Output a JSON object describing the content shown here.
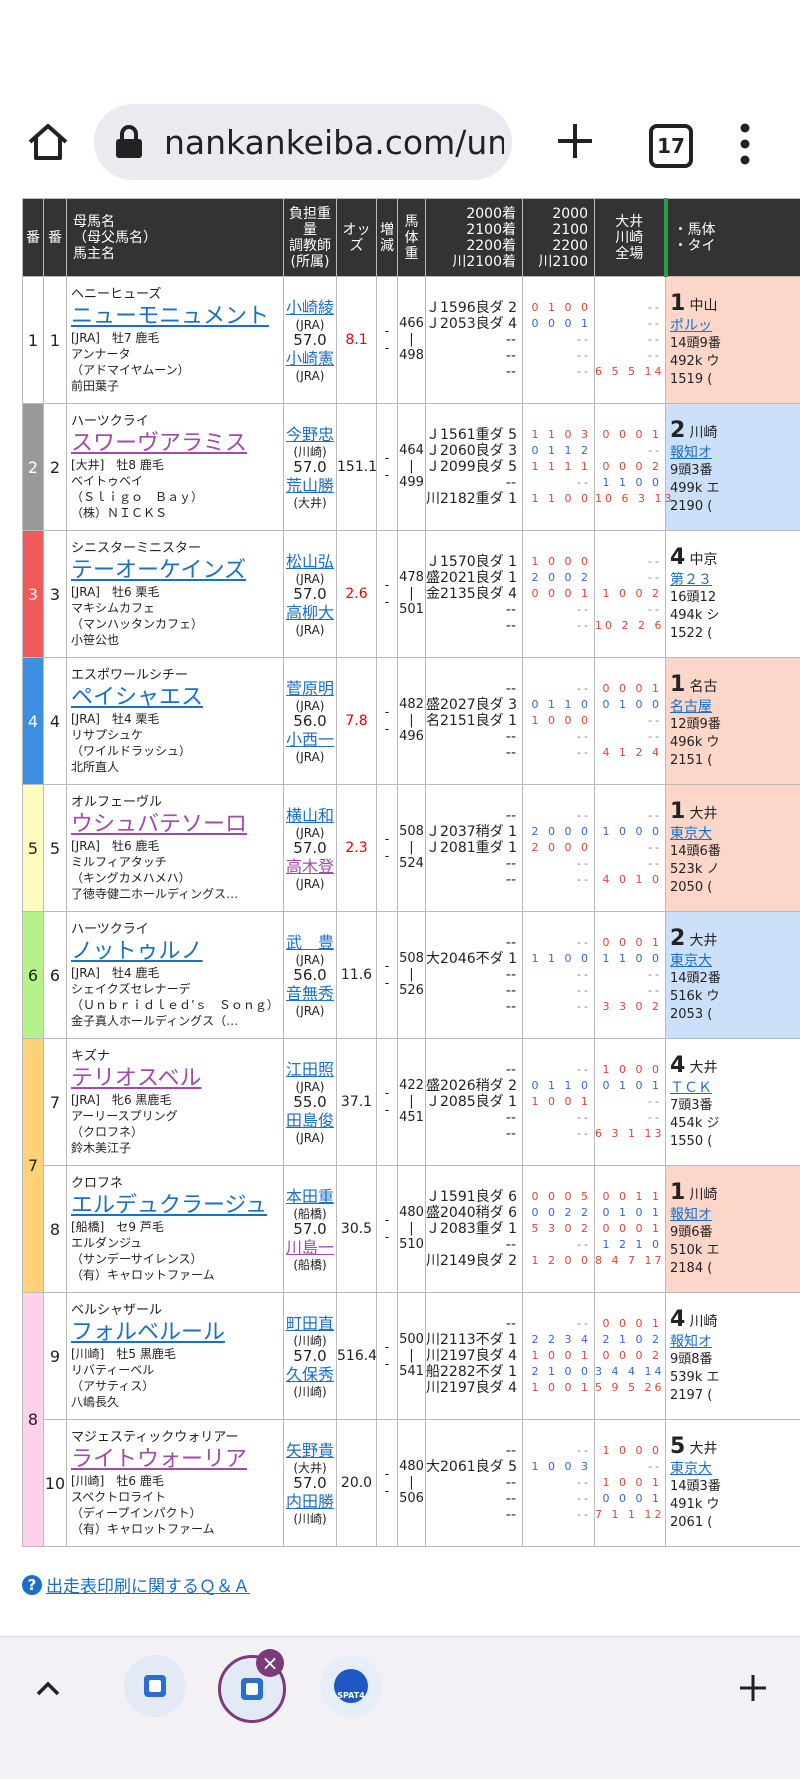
{
  "browser": {
    "url": "nankankeiba.com/um",
    "tab_count": "17"
  },
  "colors": {
    "header_bg": "#333333",
    "waku": [
      "#ffffff",
      "#999999",
      "#f05a5a",
      "#3a8fe0",
      "#fdfcc0",
      "#b6f28a",
      "#ffd27a",
      "#ffd1ea"
    ],
    "accent_link": "#1a6fc6",
    "odds_red": "#e00000"
  },
  "table": {
    "headers": {
      "waku": "番",
      "num": "番",
      "horse": [
        "母馬名",
        "（母父馬名）",
        "馬主名"
      ],
      "trainer": [
        "負担重量",
        "調教師",
        "(所属)"
      ],
      "odds": "オッズ",
      "change": "増減",
      "weight": "馬体重",
      "times": [
        "2000着",
        "2100着",
        "2200着",
        "川2100着"
      ],
      "dist": [
        "2000",
        "2100",
        "2200",
        "川2100"
      ],
      "tracks": [
        "大井",
        "川崎",
        "全場"
      ],
      "last": [
        "・馬体",
        "・タイ"
      ]
    },
    "waku_labels": [
      "1",
      "2",
      "3",
      "4",
      "5",
      "6",
      "7",
      "8"
    ],
    "rows": [
      {
        "num": "1",
        "sire": "ヘニーヒューズ",
        "name": "ニューモニュメント",
        "info": "[JRA]　牡7 鹿毛",
        "dam": "アンナータ",
        "damsire": "（アドマイヤムーン）",
        "owner": "前田葉子",
        "jockey": "小崎綾",
        "jockey_aff": "(JRA)",
        "weight": "57.0",
        "trainer": "小崎憲",
        "trainer_aff": "(JRA)",
        "odds": "8.1",
        "change": "-",
        "bw1": "466",
        "bw2": "498",
        "times": [
          "Ｊ1596良ダ 2",
          "Ｊ2053良ダ 4",
          "--",
          "--",
          "--"
        ],
        "rec": [
          "0 1 0 0",
          "0 0 0 1",
          "--",
          "--",
          "--"
        ],
        "rec2": [
          "--",
          "--",
          "--",
          "--",
          "6 5 5 14"
        ],
        "last_pos": "1",
        "last_place": "中山",
        "last_race": "ポルッ",
        "last_detail": [
          "14頭9番",
          "492k ウ",
          "1519 ("
        ]
      },
      {
        "num": "2",
        "sire": "ハーツクライ",
        "name": "スワーヴアラミス",
        "info": "[大井]　牡8 鹿毛",
        "dam": "ベイトゥベイ",
        "damsire": "（Ｓｌｉｇｏ　Ｂａｙ）",
        "owner": "（株）ＮＩＣＫＳ",
        "jockey": "今野忠",
        "jockey_aff": "(川崎)",
        "weight": "57.0",
        "trainer": "荒山勝",
        "trainer_aff": "(大井)",
        "odds": "151.1",
        "change": "-",
        "bw1": "464",
        "bw2": "499",
        "times": [
          "Ｊ1561重ダ 5",
          "Ｊ2060良ダ 3",
          "Ｊ2099良ダ 5",
          "--",
          "川2182重ダ 1"
        ],
        "rec": [
          "1 1 0 3",
          "0 1 1 2",
          "1 1 1 1",
          "--",
          "1 1 0 0"
        ],
        "rec2": [
          "0 0 0 1",
          "--",
          "0 0 0 2",
          "1 1 0 0",
          "10 6 3 13"
        ],
        "last_pos": "2",
        "last_place": "川崎",
        "last_race": "報知オ",
        "last_detail": [
          "9頭3番",
          "499k エ",
          "2190 ("
        ]
      },
      {
        "num": "3",
        "sire": "シニスターミニスター",
        "name": "テーオーケインズ",
        "info": "[JRA]　牡6 栗毛",
        "dam": "マキシムカフェ",
        "damsire": "（マンハッタンカフェ）",
        "owner": "小笹公也",
        "jockey": "松山弘",
        "jockey_aff": "(JRA)",
        "weight": "57.0",
        "trainer": "高柳大",
        "trainer_aff": "(JRA)",
        "odds": "2.6",
        "change": "-",
        "bw1": "478",
        "bw2": "501",
        "times": [
          "Ｊ1570良ダ 1",
          "盛2021良ダ 1",
          "金2135良ダ 4",
          "--",
          "--"
        ],
        "rec": [
          "1 0 0 0",
          "2 0 0 2",
          "0 0 0 1",
          "--",
          "--"
        ],
        "rec2": [
          "--",
          "--",
          "1 0 0 2",
          "--",
          "10 2 2 6"
        ],
        "last_pos": "4",
        "last_place": "中京",
        "last_race": "第２３",
        "last_detail": [
          "16頭12",
          "494k シ",
          "1522 ("
        ]
      },
      {
        "num": "4",
        "sire": "エスポワールシチー",
        "name": "ペイシャエス",
        "info": "[JRA]　牡4 栗毛",
        "dam": "リサプシュケ",
        "damsire": "（ワイルドラッシュ）",
        "owner": "北所直人",
        "jockey": "菅原明",
        "jockey_aff": "(JRA)",
        "weight": "56.0",
        "trainer": "小西一",
        "trainer_aff": "(JRA)",
        "odds": "7.8",
        "change": "-",
        "bw1": "482",
        "bw2": "496",
        "times": [
          "--",
          "盛2027良ダ 3",
          "名2151良ダ 1",
          "--",
          "--"
        ],
        "rec": [
          "--",
          "0 1 1 0",
          "1 0 0 0",
          "--",
          "--"
        ],
        "rec2": [
          "0 0 0 1",
          "0 1 0 0",
          "--",
          "--",
          "4 1 2 4"
        ],
        "last_pos": "1",
        "last_place": "名古",
        "last_race": "名古屋",
        "last_detail": [
          "12頭9番",
          "496k ウ",
          "2151 ("
        ]
      },
      {
        "num": "5",
        "sire": "オルフェーヴル",
        "name": "ウシュバテソーロ",
        "info": "[JRA]　牡6 鹿毛",
        "dam": "ミルフィアタッチ",
        "damsire": "（キングカメハメハ）",
        "owner": "了徳寺健二ホールディングス…",
        "jockey": "横山和",
        "jockey_aff": "(JRA)",
        "weight": "57.0",
        "trainer": "高木登",
        "trainer_aff": "(JRA)",
        "odds": "2.3",
        "change": "-",
        "bw1": "508",
        "bw2": "524",
        "times": [
          "--",
          "Ｊ2037稍ダ 1",
          "Ｊ2081重ダ 1",
          "--",
          "--"
        ],
        "rec": [
          "--",
          "2 0 0 0",
          "2 0 0 0",
          "--",
          "--"
        ],
        "rec2": [
          "--",
          "1 0 0 0",
          "--",
          "--",
          "4 0 1 0"
        ],
        "last_pos": "1",
        "last_place": "大井",
        "last_race": "東京大",
        "last_detail": [
          "14頭6番",
          "523k ノ",
          "2050 ("
        ]
      },
      {
        "num": "6",
        "sire": "ハーツクライ",
        "name": "ノットゥルノ",
        "info": "[JRA]　牡4 鹿毛",
        "dam": "シェイクズセレナーデ",
        "damsire": "（Ｕｎｂｒｉｄｌｅｄ’ｓ　Ｓｏｎｇ）",
        "owner": "金子真人ホールディングス（…",
        "jockey": "武　豊",
        "jockey_aff": "(JRA)",
        "weight": "56.0",
        "trainer": "音無秀",
        "trainer_aff": "(JRA)",
        "odds": "11.6",
        "change": "-",
        "bw1": "508",
        "bw2": "526",
        "times": [
          "--",
          "大2046不ダ 1",
          "--",
          "--",
          "--"
        ],
        "rec": [
          "--",
          "1 1 0 0",
          "--",
          "--",
          "--"
        ],
        "rec2": [
          "0 0 0 1",
          "1 1 0 0",
          "--",
          "--",
          "3 3 0 2"
        ],
        "last_pos": "2",
        "last_place": "大井",
        "last_race": "東京大",
        "last_detail": [
          "14頭2番",
          "516k ウ",
          "2053 ("
        ]
      },
      {
        "num": "7",
        "sire": "キズナ",
        "name": "テリオスベル",
        "info": "[JRA]　牝6 黒鹿毛",
        "dam": "アーリースプリング",
        "damsire": "（クロフネ）",
        "owner": "鈴木美江子",
        "jockey": "江田照",
        "jockey_aff": "(JRA)",
        "weight": "55.0",
        "trainer": "田島俊",
        "trainer_aff": "(JRA)",
        "odds": "37.1",
        "change": "-",
        "bw1": "422",
        "bw2": "451",
        "times": [
          "--",
          "盛2026稍ダ 2",
          "Ｊ2085良ダ 1",
          "--",
          "--"
        ],
        "rec": [
          "--",
          "0 1 1 0",
          "1 0 0 1",
          "--",
          "--"
        ],
        "rec2": [
          "1 0 0 0",
          "0 1 0 1",
          "--",
          "--",
          "6 3 1 13"
        ],
        "last_pos": "4",
        "last_place": "大井",
        "last_race": "ＴＣＫ",
        "last_detail": [
          "7頭3番",
          "454k ジ",
          "1550 ("
        ]
      },
      {
        "num": "8",
        "sire": "クロフネ",
        "name": "エルデュクラージュ",
        "info": "[船橋]　セ9 芦毛",
        "dam": "エルダンジュ",
        "damsire": "（サンデーサイレンス）",
        "owner": "（有）キャロットファーム",
        "jockey": "本田重",
        "jockey_aff": "(船橋)",
        "weight": "57.0",
        "trainer": "川島一",
        "trainer_aff": "(船橋)",
        "odds": "30.5",
        "change": "-",
        "bw1": "480",
        "bw2": "510",
        "times": [
          "Ｊ1591良ダ 6",
          "盛2040稍ダ 6",
          "Ｊ2083重ダ 1",
          "--",
          "川2149良ダ 2"
        ],
        "rec": [
          "0 0 0 5",
          "0 0 2 2",
          "5 3 0 2",
          "--",
          "1 2 0 0"
        ],
        "rec2": [
          "0 0 1 1",
          "0 1 0 1",
          "0 0 0 1",
          "1 2 1 0",
          "8 4 7 17"
        ],
        "last_pos": "1",
        "last_place": "川崎",
        "last_race": "報知オ",
        "last_detail": [
          "9頭6番",
          "510k エ",
          "2184 ("
        ]
      },
      {
        "num": "9",
        "sire": "ベルシャザール",
        "name": "フォルベルール",
        "info": "[川崎]　牡5 黒鹿毛",
        "dam": "リバティーベル",
        "damsire": "（アサティス）",
        "owner": "八嶋長久",
        "jockey": "町田直",
        "jockey_aff": "(川崎)",
        "weight": "57.0",
        "trainer": "久保秀",
        "trainer_aff": "(川崎)",
        "odds": "516.4",
        "change": "-",
        "bw1": "500",
        "bw2": "541",
        "times": [
          "--",
          "川2113不ダ 1",
          "川2197良ダ 4",
          "船2282不ダ 1",
          "川2197良ダ 4"
        ],
        "rec": [
          "--",
          "2 2 3 4",
          "1 0 0 1",
          "2 1 0 0",
          "1 0 0 1"
        ],
        "rec2": [
          "0 0 0 1",
          "2 1 0 2",
          "0 0 0 2",
          "3 4 4 14",
          "5 9 5 26"
        ],
        "last_pos": "4",
        "last_place": "川崎",
        "last_race": "報知オ",
        "last_detail": [
          "9頭8番",
          "539k エ",
          "2197 ("
        ]
      },
      {
        "num": "10",
        "sire": "マジェスティックウォリアー",
        "name": "ライトウォーリア",
        "info": "[川崎]　牡6 鹿毛",
        "dam": "スペクトロライト",
        "damsire": "（ディープインパクト）",
        "owner": "（有）キャロットファーム",
        "jockey": "矢野貴",
        "jockey_aff": "(大井)",
        "weight": "57.0",
        "trainer": "内田勝",
        "trainer_aff": "(川崎)",
        "odds": "20.0",
        "change": "-",
        "bw1": "480",
        "bw2": "506",
        "times": [
          "--",
          "大2061良ダ 5",
          "--",
          "--",
          "--"
        ],
        "rec": [
          "--",
          "1 0 0 3",
          "--",
          "--",
          "--"
        ],
        "rec2": [
          "1 0 0 0",
          "--",
          "1 0 0 1",
          "0 0 0 1",
          "7 1 1 12"
        ],
        "last_pos": "5",
        "last_place": "大井",
        "last_race": "東京大",
        "last_detail": [
          "14頭3番",
          "491k ウ",
          "2061 ("
        ]
      }
    ]
  },
  "qa_link": "出走表印刷に関するＱ＆Ａ",
  "qa_icon": "?",
  "bottom": {
    "close_glyph": "×",
    "spat_label": "SPAT4"
  }
}
